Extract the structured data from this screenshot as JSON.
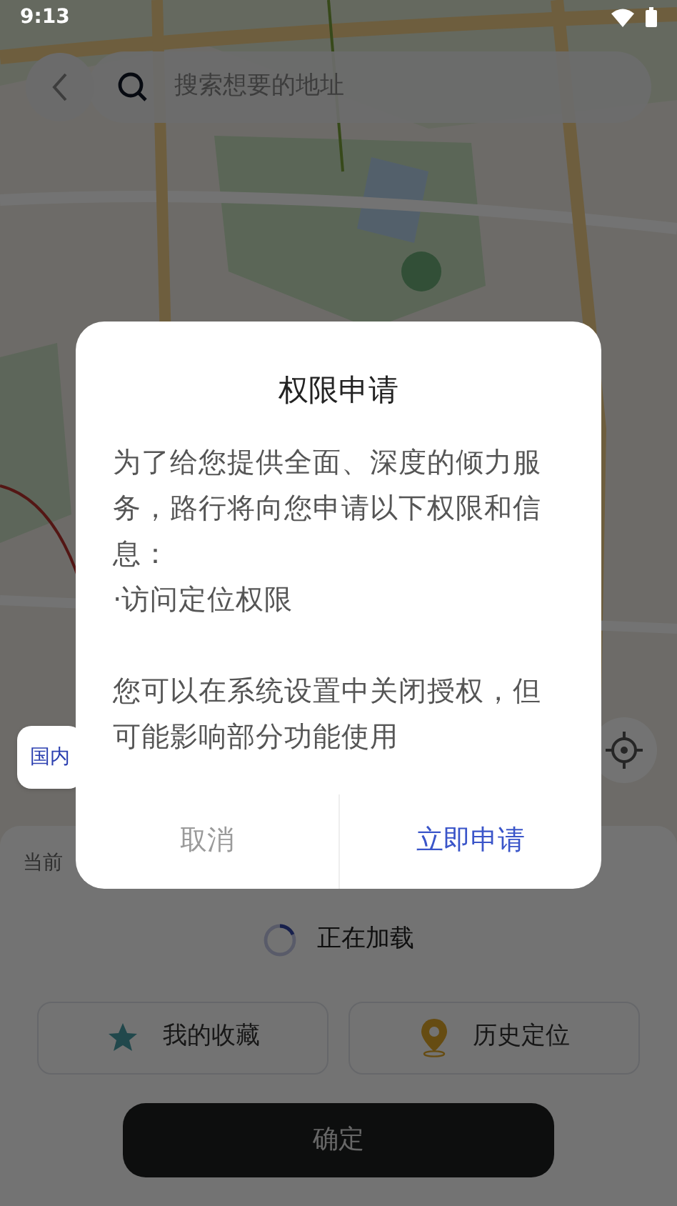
{
  "status_bar": {
    "time": "9:13"
  },
  "search": {
    "placeholder": "搜索想要的地址"
  },
  "region_tab": {
    "label": "国内"
  },
  "sheet": {
    "label": "当前",
    "loading": "正在加载",
    "confirm": "确定",
    "shortcuts": [
      {
        "kind": "favorites",
        "label": "我的收藏"
      },
      {
        "kind": "history",
        "label": "历史定位"
      }
    ]
  },
  "dialog": {
    "title": "权限申请",
    "paragraphs": [
      "为了给您提供全面、深度的倾力服务，路行将向您申请以下权限和信息：",
      "·访问定位权限",
      "您可以在系统设置中关闭授权，但可能影响部分功能使用"
    ],
    "buttons": [
      {
        "label": "取消",
        "primary": false
      },
      {
        "label": "立即申请",
        "primary": true
      }
    ]
  }
}
